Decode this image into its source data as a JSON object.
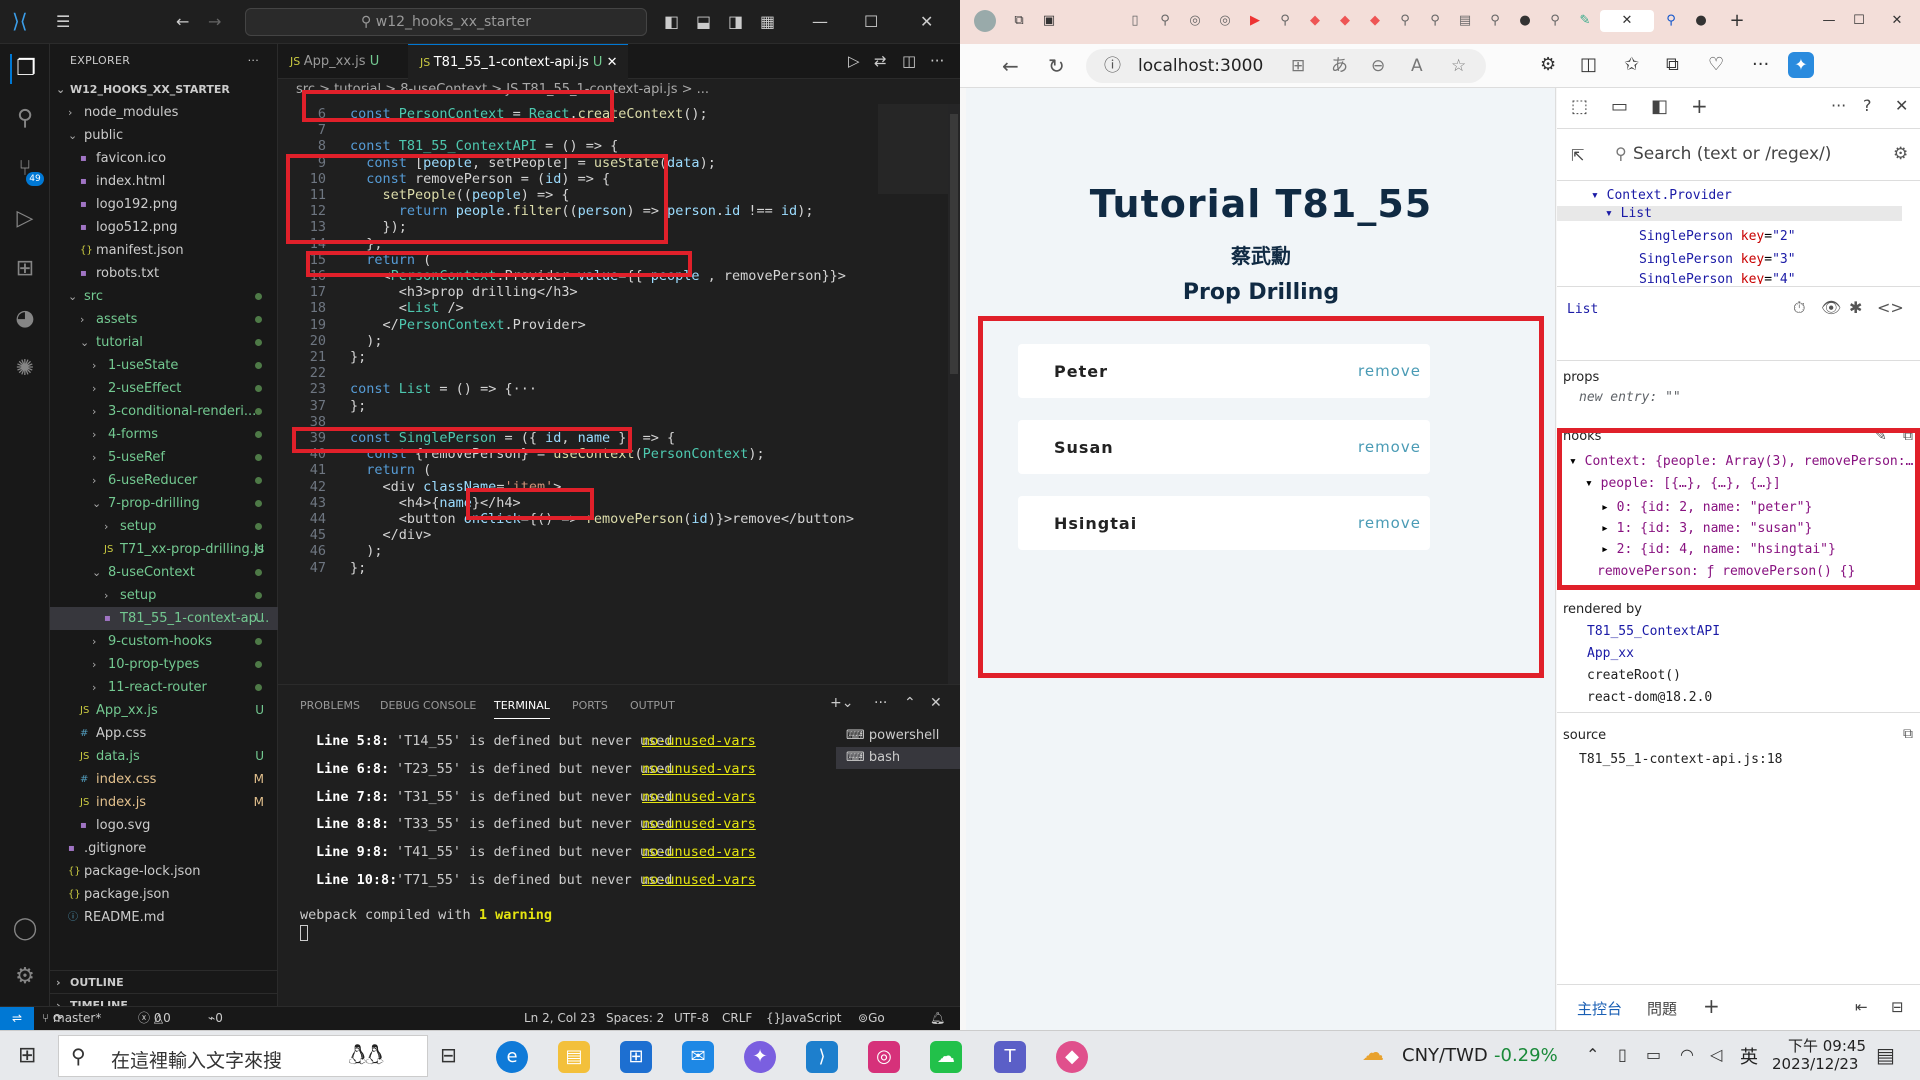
{
  "vscode": {
    "search_text": "w12_hooks_xx_starter",
    "explorer_label": "EXPLORER",
    "root_folder": "W12_HOOKS_XX_STARTER",
    "tree": [
      {
        "label": "node_modules",
        "kind": "folder",
        "depth": 1,
        "open": false,
        "deco": ""
      },
      {
        "label": "public",
        "kind": "folder",
        "depth": 1,
        "open": true,
        "deco": ""
      },
      {
        "label": "favicon.ico",
        "kind": "file",
        "depth": 2,
        "deco": ""
      },
      {
        "label": "index.html",
        "kind": "file",
        "depth": 2,
        "deco": ""
      },
      {
        "label": "logo192.png",
        "kind": "file",
        "depth": 2,
        "deco": ""
      },
      {
        "label": "logo512.png",
        "kind": "file",
        "depth": 2,
        "deco": ""
      },
      {
        "label": "manifest.json",
        "kind": "file",
        "depth": 2,
        "deco": ""
      },
      {
        "label": "robots.txt",
        "kind": "file",
        "depth": 2,
        "deco": ""
      },
      {
        "label": "src",
        "kind": "folder",
        "depth": 1,
        "open": true,
        "deco": "dot"
      },
      {
        "label": "assets",
        "kind": "folder",
        "depth": 2,
        "open": false,
        "deco": "dot"
      },
      {
        "label": "tutorial",
        "kind": "folder",
        "depth": 2,
        "open": true,
        "deco": "dot"
      },
      {
        "label": "1-useState",
        "kind": "folder",
        "depth": 3,
        "open": false,
        "deco": "dot"
      },
      {
        "label": "2-useEffect",
        "kind": "folder",
        "depth": 3,
        "open": false,
        "deco": "dot"
      },
      {
        "label": "3-conditional-renderi...",
        "kind": "folder",
        "depth": 3,
        "open": false,
        "deco": "dot"
      },
      {
        "label": "4-forms",
        "kind": "folder",
        "depth": 3,
        "open": false,
        "deco": "dot"
      },
      {
        "label": "5-useRef",
        "kind": "folder",
        "depth": 3,
        "open": false,
        "deco": "dot"
      },
      {
        "label": "6-useReducer",
        "kind": "folder",
        "depth": 3,
        "open": false,
        "deco": "dot"
      },
      {
        "label": "7-prop-drilling",
        "kind": "folder",
        "depth": 3,
        "open": true,
        "deco": "dot"
      },
      {
        "label": "setup",
        "kind": "folder",
        "depth": 4,
        "open": false,
        "deco": "dot"
      },
      {
        "label": "T71_xx-prop-drilling.js",
        "kind": "file",
        "depth": 4,
        "deco": "U"
      },
      {
        "label": "8-useContext",
        "kind": "folder",
        "depth": 3,
        "open": true,
        "deco": "dot"
      },
      {
        "label": "setup",
        "kind": "folder",
        "depth": 4,
        "open": false,
        "deco": "dot"
      },
      {
        "label": "T81_55_1-context-ap...",
        "kind": "file",
        "depth": 4,
        "deco": "U",
        "selected": true
      },
      {
        "label": "9-custom-hooks",
        "kind": "folder",
        "depth": 3,
        "open": false,
        "deco": "dot"
      },
      {
        "label": "10-prop-types",
        "kind": "folder",
        "depth": 3,
        "open": false,
        "deco": "dot"
      },
      {
        "label": "11-react-router",
        "kind": "folder",
        "depth": 3,
        "open": false,
        "deco": "dot"
      },
      {
        "label": "App_xx.js",
        "kind": "file",
        "depth": 2,
        "deco": "U"
      },
      {
        "label": "App.css",
        "kind": "file",
        "depth": 2,
        "deco": ""
      },
      {
        "label": "data.js",
        "kind": "file",
        "depth": 2,
        "deco": "U"
      },
      {
        "label": "index.css",
        "kind": "file",
        "depth": 2,
        "deco": "M"
      },
      {
        "label": "index.js",
        "kind": "file",
        "depth": 2,
        "deco": "M"
      },
      {
        "label": "logo.svg",
        "kind": "file",
        "depth": 2,
        "deco": ""
      },
      {
        "label": ".gitignore",
        "kind": "file",
        "depth": 1,
        "deco": ""
      },
      {
        "label": "package-lock.json",
        "kind": "file",
        "depth": 1,
        "deco": ""
      },
      {
        "label": "package.json",
        "kind": "file",
        "depth": 1,
        "deco": ""
      },
      {
        "label": "README.md",
        "kind": "file",
        "depth": 1,
        "deco": ""
      }
    ],
    "outline_label": "OUTLINE",
    "timeline_label": "TIMELINE",
    "tabs": [
      {
        "label": "App_xx.js",
        "badge": "U"
      },
      {
        "label": "T81_55_1-context-api.js",
        "badge": "U"
      }
    ],
    "breadcrumb": "src  >  tutorial  >  8-useContext  >  JS  T81_55_1-context-api.js  >  ...",
    "code": [
      {
        "n": "6",
        "t": "const PersonContext = React.createContext();"
      },
      {
        "n": "7",
        "t": ""
      },
      {
        "n": "8",
        "t": "const T81_55_ContextAPI = () => {"
      },
      {
        "n": "9",
        "t": "  const [people, setPeople] = useState(data);"
      },
      {
        "n": "10",
        "t": "  const removePerson = (id) => {"
      },
      {
        "n": "11",
        "t": "    setPeople((people) => {"
      },
      {
        "n": "12",
        "t": "      return people.filter((person) => person.id !== id);"
      },
      {
        "n": "13",
        "t": "    });"
      },
      {
        "n": "14",
        "t": "  };"
      },
      {
        "n": "15",
        "t": "  return ("
      },
      {
        "n": "16",
        "t": "    <PersonContext.Provider value={{ people , removePerson}}>"
      },
      {
        "n": "17",
        "t": "      <h3>prop drilling</h3>"
      },
      {
        "n": "18",
        "t": "      <List />"
      },
      {
        "n": "19",
        "t": "    </PersonContext.Provider>"
      },
      {
        "n": "20",
        "t": "  );"
      },
      {
        "n": "21",
        "t": "};"
      },
      {
        "n": "22",
        "t": ""
      },
      {
        "n": "23",
        "t": "const List = () => {···"
      },
      {
        "n": "37",
        "t": "};"
      },
      {
        "n": "38",
        "t": ""
      },
      {
        "n": "39",
        "t": "const SinglePerson = ({ id, name }) => {"
      },
      {
        "n": "40",
        "t": "  const {removePerson} = useContext(PersonContext);"
      },
      {
        "n": "41",
        "t": "  return ("
      },
      {
        "n": "42",
        "t": "    <div className='item'>"
      },
      {
        "n": "43",
        "t": "      <h4>{name}</h4>"
      },
      {
        "n": "44",
        "t": "      <button onClick={() => removePerson(id)}>remove</button>"
      },
      {
        "n": "45",
        "t": "    </div>"
      },
      {
        "n": "46",
        "t": "  );"
      },
      {
        "n": "47",
        "t": "};"
      }
    ],
    "panel_tabs": [
      "PROBLEMS",
      "DEBUG CONSOLE",
      "TERMINAL",
      "PORTS",
      "OUTPUT"
    ],
    "terminal": [
      {
        "loc": "Line 5:8:",
        "msg": "'T14_55' is defined but never used",
        "rule": "no-unused-vars"
      },
      {
        "loc": "Line 6:8:",
        "msg": "'T23_55' is defined but never used",
        "rule": "no-unused-vars"
      },
      {
        "loc": "Line 7:8:",
        "msg": "'T31_55' is defined but never used",
        "rule": "no-unused-vars"
      },
      {
        "loc": "Line 8:8:",
        "msg": "'T33_55' is defined but never used",
        "rule": "no-unused-vars"
      },
      {
        "loc": "Line 9:8:",
        "msg": "'T41_55' is defined but never used",
        "rule": "no-unused-vars"
      },
      {
        "loc": "Line 10:8:",
        "msg": "'T71_55' is defined but never used",
        "rule": "no-unused-vars"
      }
    ],
    "compiled_prefix": "webpack compiled with ",
    "compiled_count": "1",
    "compiled_suffix": " warning",
    "shells": [
      "powershell",
      "bash"
    ],
    "status": {
      "branch": "master*",
      "errors": "0",
      "warnings": "0",
      "ports": "0",
      "position": "Ln 2, Col 23",
      "spaces": "Spaces: 2",
      "encoding": "UTF-8",
      "eol": "CRLF",
      "language": "JavaScript",
      "golive": "Go Live"
    }
  },
  "browser": {
    "url": "localhost:3000",
    "page": {
      "title": "Tutorial T81_55",
      "author": "蔡武勳",
      "subtitle": "Prop Drilling",
      "people": [
        "Peter",
        "Susan",
        "Hsingtai"
      ],
      "remove_label": "remove"
    },
    "devtools": {
      "search_placeholder": "Search (text or /regex/)",
      "tree": [
        "Context.Provider",
        "List",
        "SinglePerson",
        "SinglePerson",
        "SinglePerson"
      ],
      "keys": [
        "\"2\"",
        "\"3\"",
        "\"4\""
      ],
      "selected": "List",
      "props_label": "props",
      "new_entry": "new entry: \"\"",
      "hooks_label": "hooks",
      "context_line": "Context: {people: Array(3), removePerson:…",
      "people_line": "people: [{…}, {…}, {…}]",
      "items": [
        "0: {id: 2, name: \"peter\"}",
        "1: {id: 3, name: \"susan\"}",
        "2: {id: 4, name: \"hsingtai\"}"
      ],
      "remove_line": "removePerson: ƒ removePerson() {}",
      "rendered_by_label": "rendered by",
      "rendered_by": [
        "T81_55_ContextAPI",
        "App_xx",
        "createRoot()",
        "react-dom@18.2.0"
      ],
      "source_label": "source",
      "source": "T81_55_1-context-api.js:18",
      "bottom_tabs": [
        "主控台",
        "問題"
      ]
    }
  },
  "taskbar": {
    "search_placeholder": "在這裡輸入文字來搜",
    "currency": "CNY/TWD",
    "change": "-0.29%",
    "ime": "英",
    "time": "下午 09:45",
    "date": "2023/12/23"
  },
  "colors": {
    "highlight": "#e0202a",
    "accent": "#0078d4"
  }
}
